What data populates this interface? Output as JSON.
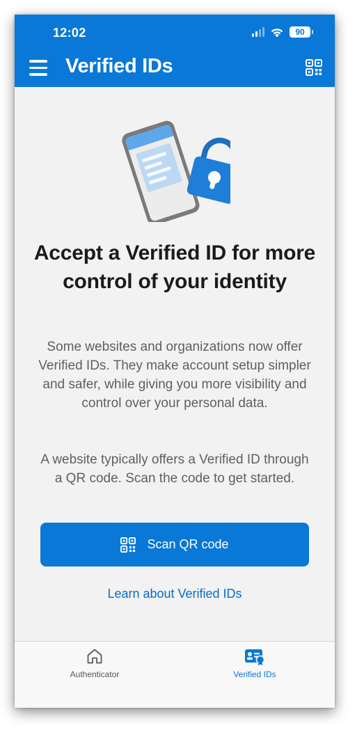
{
  "status_bar": {
    "time": "12:02",
    "battery": "90"
  },
  "header": {
    "title": "Verified IDs"
  },
  "main": {
    "heading": "Accept a Verified ID for more control of your identity",
    "description": "Some websites and organizations now offer Verified IDs. They make account setup simpler and safer, while giving you more visibility and control over your personal data.",
    "instruction": "A website typically offers a Verified ID through a QR code. Scan the code to get started.",
    "scan_button_label": "Scan QR code",
    "learn_link": "Learn about Verified IDs"
  },
  "tabbar": {
    "tabs": [
      {
        "label": "Authenticator",
        "icon": "home-icon",
        "active": false
      },
      {
        "label": "Verified IDs",
        "icon": "verified-id-icon",
        "active": true
      }
    ]
  },
  "colors": {
    "accent": "#0a78d7",
    "background": "#f2f2f2",
    "text_primary": "#1b1b1b",
    "text_secondary": "#5f5f5f"
  }
}
